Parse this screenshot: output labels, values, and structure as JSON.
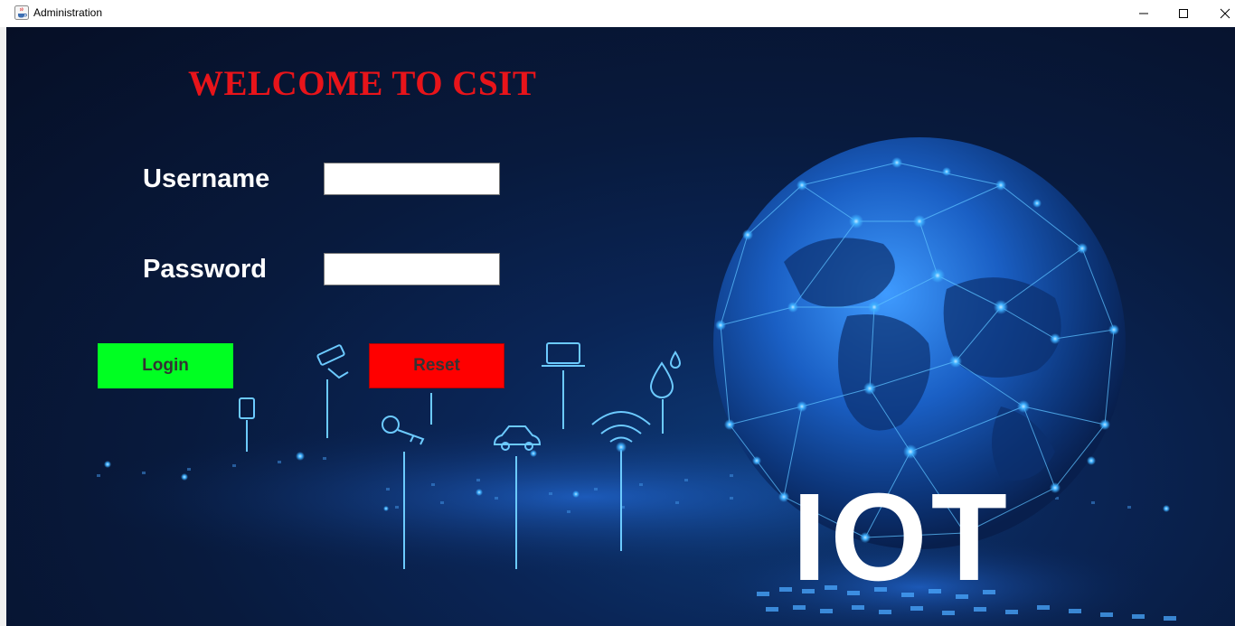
{
  "window": {
    "title": "Administration",
    "icon": "java-cup-icon",
    "controls": {
      "minimize": "—",
      "maximize": "☐",
      "close": "✕"
    }
  },
  "login": {
    "heading": "WELCOME TO CSIT",
    "username_label": "Username",
    "username_value": "",
    "password_label": "Password",
    "password_value": "",
    "login_button": "Login",
    "reset_button": "Reset"
  },
  "banner": {
    "text": "IOT"
  },
  "colors": {
    "heading": "#e8141a",
    "login_button": "#00ff22",
    "reset_button": "#ff0000",
    "background": "#081a3d",
    "accent_glow": "#3fa9ff"
  }
}
